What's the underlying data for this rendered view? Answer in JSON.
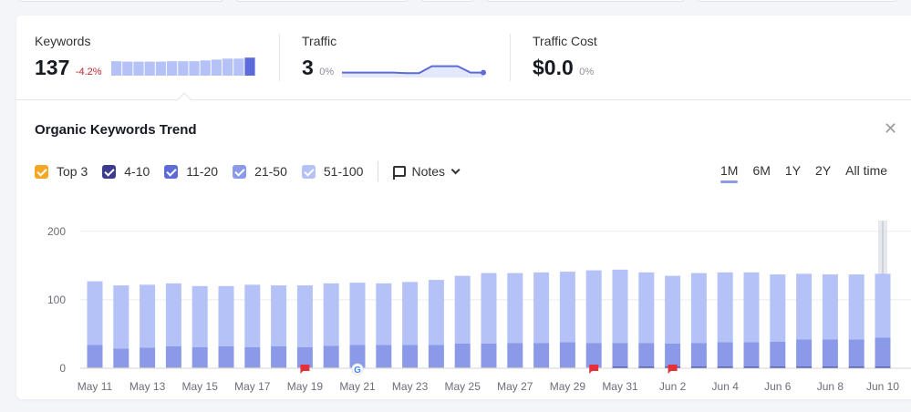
{
  "metrics": {
    "keywords": {
      "label": "Keywords",
      "value": "137",
      "change": "-4.2%"
    },
    "traffic": {
      "label": "Traffic",
      "value": "3",
      "change": "0%"
    },
    "traffic_cost": {
      "label": "Traffic Cost",
      "value": "$0.0",
      "change": "0%"
    }
  },
  "keywords_spark": [
    0.72,
    0.7,
    0.7,
    0.7,
    0.7,
    0.72,
    0.72,
    0.72,
    0.76,
    0.8,
    0.85,
    0.85,
    0.9
  ],
  "traffic_spark": [
    0.1,
    0.1,
    0.1,
    0.1,
    0.1,
    0.05,
    0.05,
    0.6,
    0.6,
    0.6,
    0.1,
    0.1
  ],
  "panel": {
    "title": "Organic Keywords Trend",
    "close_icon": "close-icon"
  },
  "legend": [
    {
      "label": "Top 3",
      "color": "#f5a623"
    },
    {
      "label": "4-10",
      "color": "#3d3b8e"
    },
    {
      "label": "11-20",
      "color": "#5c6bd9"
    },
    {
      "label": "21-50",
      "color": "#8b9ae8"
    },
    {
      "label": "51-100",
      "color": "#b5c2f7"
    }
  ],
  "notes_label": "Notes",
  "ranges": [
    "1M",
    "6M",
    "1Y",
    "2Y",
    "All time"
  ],
  "active_range": "1M",
  "chart_data": {
    "type": "bar",
    "stacked": true,
    "ylim": [
      0,
      200
    ],
    "yticks": [
      0,
      100,
      200
    ],
    "xtick_labels": [
      "May 11",
      "May 13",
      "May 15",
      "May 17",
      "May 19",
      "May 21",
      "May 23",
      "May 25",
      "May 27",
      "May 29",
      "May 31",
      "Jun 2",
      "Jun 4",
      "Jun 6",
      "Jun 8",
      "Jun 10"
    ],
    "categories": [
      "May 11",
      "May 12",
      "May 13",
      "May 14",
      "May 15",
      "May 16",
      "May 17",
      "May 18",
      "May 19",
      "May 20",
      "May 21",
      "May 22",
      "May 23",
      "May 24",
      "May 25",
      "May 26",
      "May 27",
      "May 28",
      "May 29",
      "May 30",
      "May 31",
      "Jun 1",
      "Jun 2",
      "Jun 3",
      "Jun 4",
      "Jun 5",
      "Jun 6",
      "Jun 7",
      "Jun 8",
      "Jun 9",
      "Jun 10"
    ],
    "series": [
      {
        "name": "Top 3",
        "values": [
          1,
          1,
          1,
          1,
          1,
          1,
          1,
          1,
          1,
          1,
          1,
          1,
          1,
          1,
          1,
          1,
          1,
          1,
          1,
          1,
          0,
          0,
          0,
          0,
          0,
          0,
          0,
          0,
          0,
          0,
          0
        ]
      },
      {
        "name": "4-10",
        "values": [
          0,
          0,
          0,
          0,
          0,
          0,
          0,
          0,
          0,
          0,
          0,
          0,
          0,
          0,
          0,
          0,
          0,
          0,
          0,
          0,
          2,
          2,
          2,
          2,
          2,
          2,
          2,
          2,
          2,
          2,
          2
        ]
      },
      {
        "name": "11-20",
        "values": [
          0,
          0,
          0,
          0,
          0,
          0,
          0,
          0,
          0,
          0,
          0,
          0,
          0,
          0,
          0,
          0,
          0,
          0,
          0,
          0,
          0,
          0,
          0,
          0,
          0,
          0,
          0,
          0,
          0,
          0,
          0
        ]
      },
      {
        "name": "21-50",
        "values": [
          33,
          28,
          29,
          31,
          30,
          31,
          30,
          31,
          30,
          32,
          33,
          33,
          33,
          33,
          35,
          35,
          36,
          36,
          37,
          36,
          35,
          35,
          34,
          35,
          36,
          36,
          37,
          40,
          40,
          40,
          43
        ]
      },
      {
        "name": "51-100",
        "values": [
          93,
          92,
          92,
          92,
          89,
          88,
          91,
          89,
          90,
          91,
          91,
          90,
          92,
          95,
          99,
          103,
          102,
          103,
          103,
          106,
          107,
          103,
          99,
          102,
          102,
          102,
          98,
          96,
          95,
          95,
          93
        ]
      }
    ],
    "annotations": [
      {
        "category": "May 19",
        "type": "note"
      },
      {
        "category": "May 21",
        "type": "google-update"
      },
      {
        "category": "May 30",
        "type": "note"
      },
      {
        "category": "Jun 2",
        "type": "note"
      }
    ],
    "hover_category": "Jun 10"
  }
}
